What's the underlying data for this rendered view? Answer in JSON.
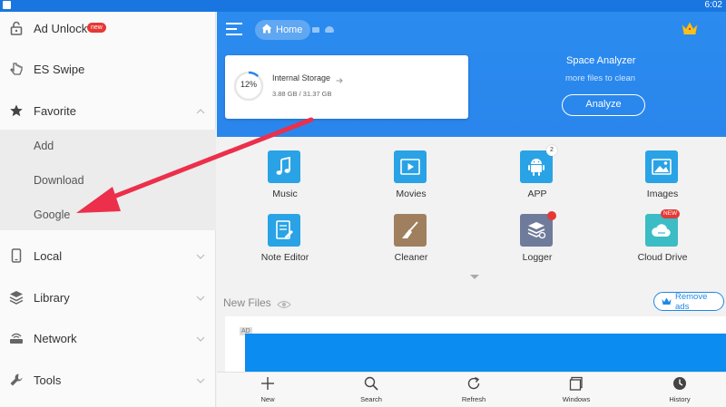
{
  "status_bar": {
    "time": "6:02"
  },
  "sidebar": {
    "items": [
      {
        "label": "Ad Unlock",
        "icon": "lock-icon",
        "badge": "new"
      },
      {
        "label": "ES Swipe",
        "icon": "swipe-hand-icon"
      },
      {
        "label": "Favorite",
        "icon": "star-icon",
        "expanded": true
      },
      {
        "label": "Local",
        "icon": "phone-icon"
      },
      {
        "label": "Library",
        "icon": "layers-icon"
      },
      {
        "label": "Network",
        "icon": "router-icon"
      },
      {
        "label": "Tools",
        "icon": "wrench-icon"
      }
    ],
    "favorite_children": [
      "Add",
      "Download",
      "Google"
    ]
  },
  "header": {
    "home_label": "Home",
    "storage": {
      "percent_label": "12%",
      "percent": 12,
      "title": "Internal Storage",
      "usage": "3.88 GB / 31.37 GB"
    },
    "space_analyzer": {
      "title": "Space Analyzer",
      "subtitle": "more files to clean",
      "button": "Analyze"
    }
  },
  "grid": [
    {
      "label": "Music",
      "icon": "music-note-icon",
      "color": "#29a3e5"
    },
    {
      "label": "Movies",
      "icon": "play-video-icon",
      "color": "#29a3e5"
    },
    {
      "label": "APP",
      "icon": "android-icon",
      "color": "#29a3e5",
      "badge": "2"
    },
    {
      "label": "Images",
      "icon": "image-icon",
      "color": "#29a3e5"
    },
    {
      "label": "Note Editor",
      "icon": "note-edit-icon",
      "color": "#29a3e5"
    },
    {
      "label": "Cleaner",
      "icon": "broom-icon",
      "color": "#a07f5f"
    },
    {
      "label": "Logger",
      "icon": "logger-stack-icon",
      "color": "#6f7b9a",
      "dot": true
    },
    {
      "label": "Cloud Drive",
      "icon": "cloud-icon",
      "color": "#3cbcc4",
      "tag": "NEW"
    }
  ],
  "new_files": {
    "title": "New Files",
    "remove_ads": "Remove ads",
    "ad_tag": "AD"
  },
  "bottom_bar": [
    {
      "label": "New",
      "icon": "plus-icon"
    },
    {
      "label": "Search",
      "icon": "search-icon"
    },
    {
      "label": "Refresh",
      "icon": "refresh-icon"
    },
    {
      "label": "Windows",
      "icon": "windows-icon"
    },
    {
      "label": "History",
      "icon": "clock-icon"
    }
  ],
  "colors": {
    "accent": "#2a86ec",
    "annotation_arrow": "#ec2f4b",
    "ad_banner": "#0a8cf0"
  }
}
